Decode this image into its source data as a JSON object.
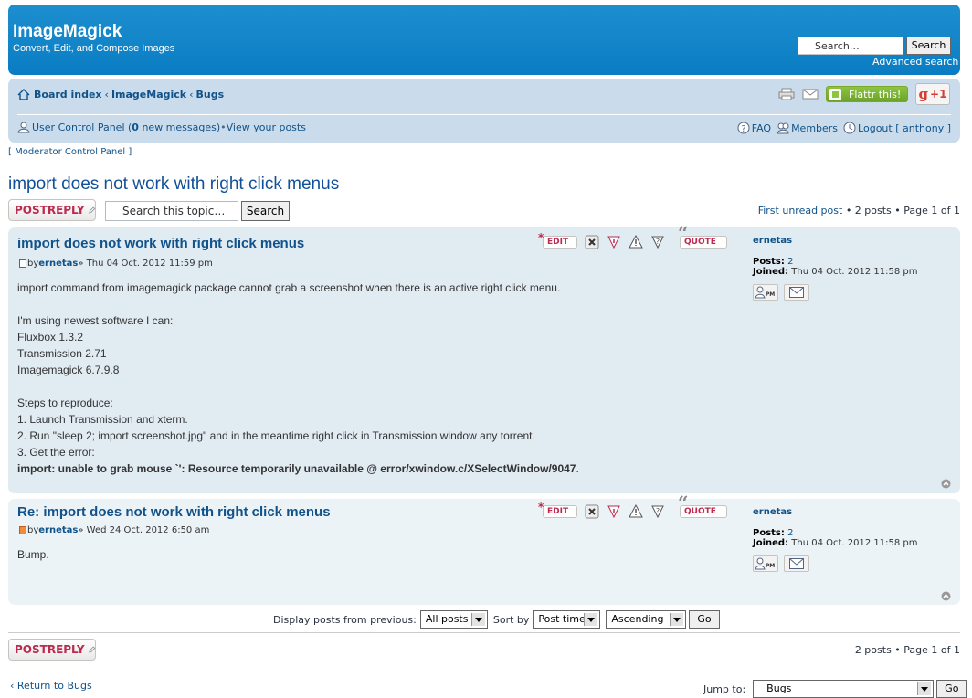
{
  "header": {
    "site_title": "ImageMagick",
    "site_desc": "Convert, Edit, and Compose Images",
    "search_placeholder": "Search…",
    "search_button": "Search",
    "advanced_search": "Advanced search"
  },
  "nav": {
    "crumbs": [
      "Board index",
      "ImageMagick",
      "Bugs"
    ],
    "crumb_sep": "‹",
    "flattr_label": "Flattr this!",
    "gplus_label": "+1",
    "ucp_label": "User Control Panel (",
    "ucp_count": "0",
    "ucp_suffix": " new messages)",
    "ucp_dot": " • ",
    "view_posts": "View your posts",
    "faq": "FAQ",
    "members": "Members",
    "logout": "Logout [ anthony ]"
  },
  "mcp": "[ Moderator Control Panel ]",
  "topic": {
    "title": "import does not work with right click menus",
    "postreply": "POSTREPLY",
    "search_placeholder": "Search this topic…",
    "search_button": "Search",
    "pagination_top_link": "First unread post",
    "pagination_top_rest": " • 2 posts • Page 1 of 1",
    "pagination_bottom": "2 posts • Page 1 of 1"
  },
  "actions": {
    "edit": "EDIT",
    "quote": "QUOTE"
  },
  "posts": [
    {
      "title": "import does not work with right click menus",
      "by": "by ",
      "author": "ernetas",
      "date": " » Thu 04 Oct. 2012 11:59 pm",
      "lines": [
        "import command from imagemagick package cannot grab a screenshot when there is an active right click menu.",
        "",
        "I'm using newest software I can:",
        "Fluxbox 1.3.2",
        "Transmission 2.71",
        "Imagemagick 6.7.9.8",
        "",
        "Steps to reproduce:",
        "1. Launch Transmission and xterm.",
        "2. Run \"sleep 2; import screenshot.jpg\" and in the meantime right click in Transmission window any torrent.",
        "3. Get the error:"
      ],
      "error_line": "import: unable to grab mouse `': Resource temporarily unavailable @ error/xwindow.c/XSelectWindow/9047",
      "error_tail": ".",
      "profile": {
        "name": "ernetas",
        "posts_label": "Posts:",
        "posts": " 2",
        "joined_label": "Joined:",
        "joined": " Thu 04 Oct. 2012 11:58 pm"
      }
    },
    {
      "title": "Re: import does not work with right click menus",
      "by": "by ",
      "author": "ernetas",
      "date": " » Wed 24 Oct. 2012 6:50 am",
      "lines": [
        "Bump."
      ],
      "profile": {
        "name": "ernetas",
        "posts_label": "Posts:",
        "posts": " 2",
        "joined_label": "Joined:",
        "joined": " Thu 04 Oct. 2012 11:58 pm"
      }
    }
  ],
  "sortbar": {
    "display_label": "Display posts from previous:",
    "display_value": "All posts",
    "sort_label": "Sort by",
    "sort_value": "Post time",
    "order_value": "Ascending",
    "go": "Go"
  },
  "footer": {
    "return": "Return to Bugs",
    "jump_label": "Jump to:",
    "jump_value": "Bugs",
    "go": "Go"
  }
}
